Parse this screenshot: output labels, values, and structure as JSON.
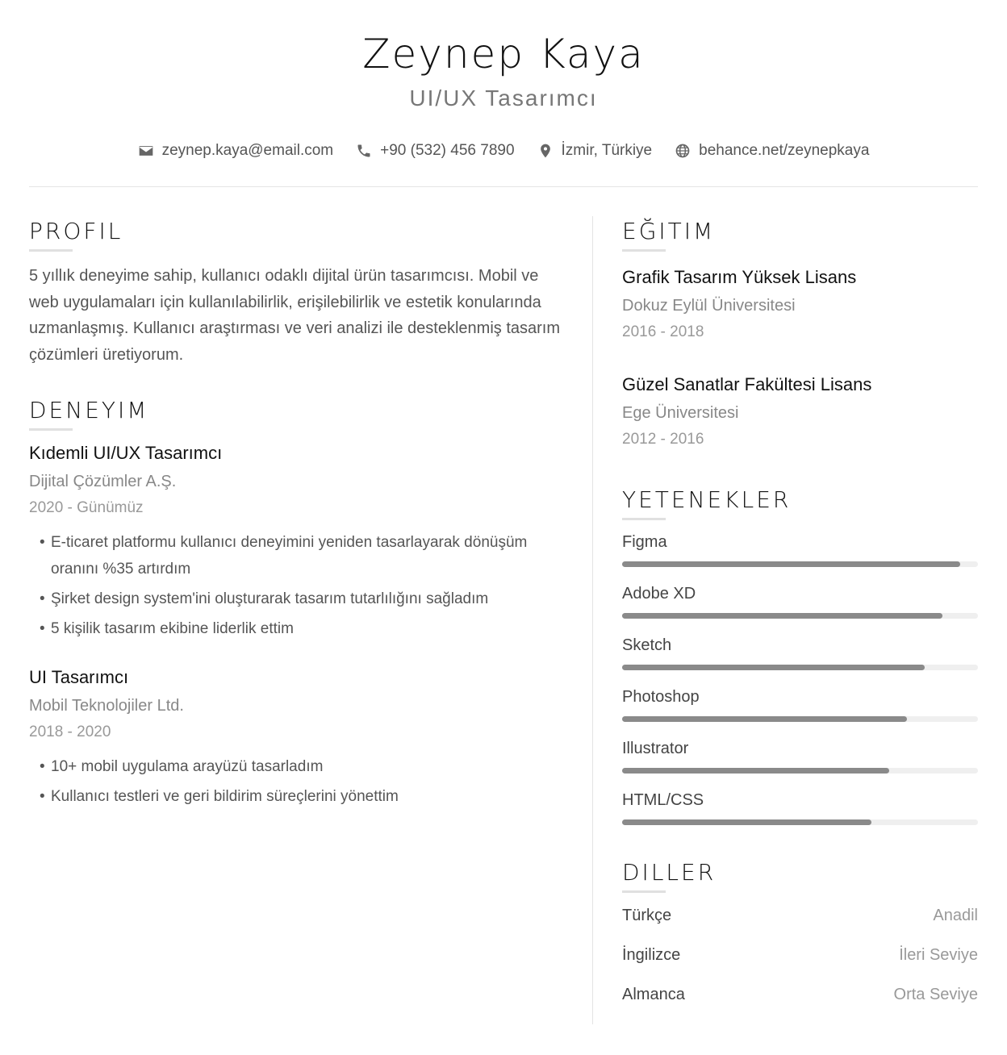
{
  "header": {
    "name": "Zeynep Kaya",
    "title": "UI/UX Tasarımcı"
  },
  "contacts": [
    {
      "icon": "email-icon",
      "text": "zeynep.kaya@email.com"
    },
    {
      "icon": "phone-icon",
      "text": "+90 (532) 456 7890"
    },
    {
      "icon": "location-icon",
      "text": "İzmir, Türkiye"
    },
    {
      "icon": "globe-icon",
      "text": "behance.net/zeynepkaya"
    }
  ],
  "profile": {
    "heading": "PROFIL",
    "text": "5 yıllık deneyime sahip, kullanıcı odaklı dijital ürün tasarımcısı. Mobil ve web uygulamaları için kullanılabilirlik, erişilebilirlik ve estetik konularında uzmanlaşmış. Kullanıcı araştırması ve veri analizi ile desteklenmiş tasarım çözümleri üretiyorum."
  },
  "experience": {
    "heading": "DENEYIM",
    "jobs": [
      {
        "title": "Kıdemli UI/UX Tasarımcı",
        "company": "Dijital Çözümler A.Ş.",
        "date": "2020 - Günümüz",
        "bullets": [
          "E-ticaret platformu kullanıcı deneyimini yeniden tasarlayarak dönüşüm oranını %35 artırdım",
          "Şirket design system'ini oluşturarak tasarım tutarlılığını sağladım",
          "5 kişilik tasarım ekibine liderlik ettim"
        ]
      },
      {
        "title": "UI Tasarımcı",
        "company": "Mobil Teknolojiler Ltd.",
        "date": "2018 - 2020",
        "bullets": [
          "10+ mobil uygulama arayüzü tasarladım",
          "Kullanıcı testleri ve geri bildirim süreçlerini yönettim"
        ]
      }
    ]
  },
  "education": {
    "heading": "EĞITIM",
    "items": [
      {
        "degree": "Grafik Tasarım Yüksek Lisans",
        "school": "Dokuz Eylül Üniversitesi",
        "date": "2016 - 2018"
      },
      {
        "degree": "Güzel Sanatlar Fakültesi Lisans",
        "school": "Ege Üniversitesi",
        "date": "2012 - 2016"
      }
    ]
  },
  "skills": {
    "heading": "YETENEKLER",
    "items": [
      {
        "name": "Figma",
        "level": 0.95
      },
      {
        "name": "Adobe XD",
        "level": 0.9
      },
      {
        "name": "Sketch",
        "level": 0.85
      },
      {
        "name": "Photoshop",
        "level": 0.8
      },
      {
        "name": "Illustrator",
        "level": 0.75
      },
      {
        "name": "HTML/CSS",
        "level": 0.7
      }
    ]
  },
  "languages": {
    "heading": "DILLER",
    "items": [
      {
        "name": "Türkçe",
        "level": "Anadil"
      },
      {
        "name": "İngilizce",
        "level": "İleri Seviye"
      },
      {
        "name": "Almanca",
        "level": "Orta Seviye"
      }
    ]
  }
}
